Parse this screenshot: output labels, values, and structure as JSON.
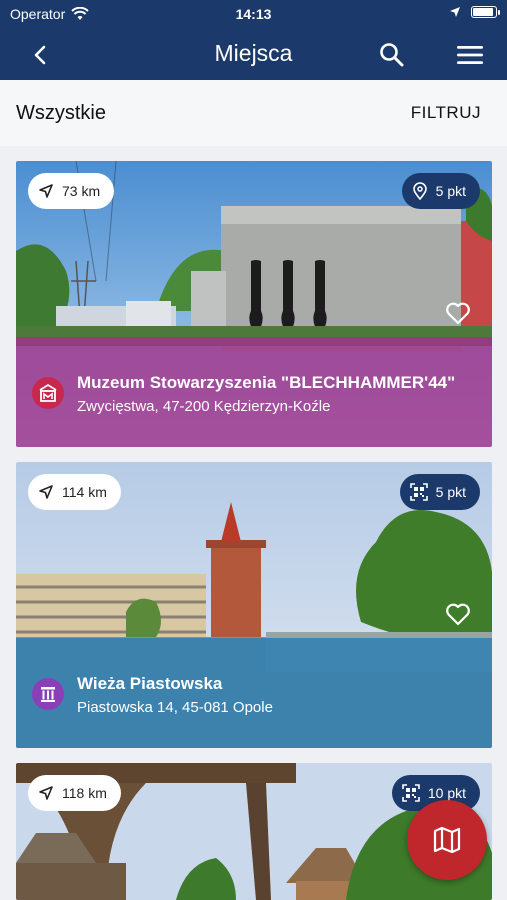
{
  "status_bar": {
    "carrier": "Operator",
    "time": "14:13"
  },
  "nav": {
    "title": "Miejsca",
    "back_icon": "chevron-left-icon",
    "search_icon": "search-icon",
    "menu_icon": "hamburger-menu-icon"
  },
  "sub_header": {
    "label": "Wszystkie",
    "filter_label": "FILTRUJ"
  },
  "places": [
    {
      "distance": "73 km",
      "points": "5 pkt",
      "points_icon": "location-pin-icon",
      "name": "Muzeum Stowarzyszenia \"BLECHHAMMER'44\"",
      "address": "Zwycięstwa, 47-200 Kędzierzyn-Koźle",
      "category_icon": "museum-icon",
      "overlay_color": "#a0328a"
    },
    {
      "distance": "114 km",
      "points": "5 pkt",
      "points_icon": "qr-code-icon",
      "name": "Wieża Piastowska",
      "address": "Piastowska 14, 45-081 Opole",
      "category_icon": "monument-columns-icon",
      "overlay_color": "#2a7fb4"
    },
    {
      "distance": "118 km",
      "points": "10 pkt",
      "points_icon": "qr-code-icon"
    }
  ],
  "fab": {
    "icon": "map-icon",
    "color": "#c0272d"
  }
}
